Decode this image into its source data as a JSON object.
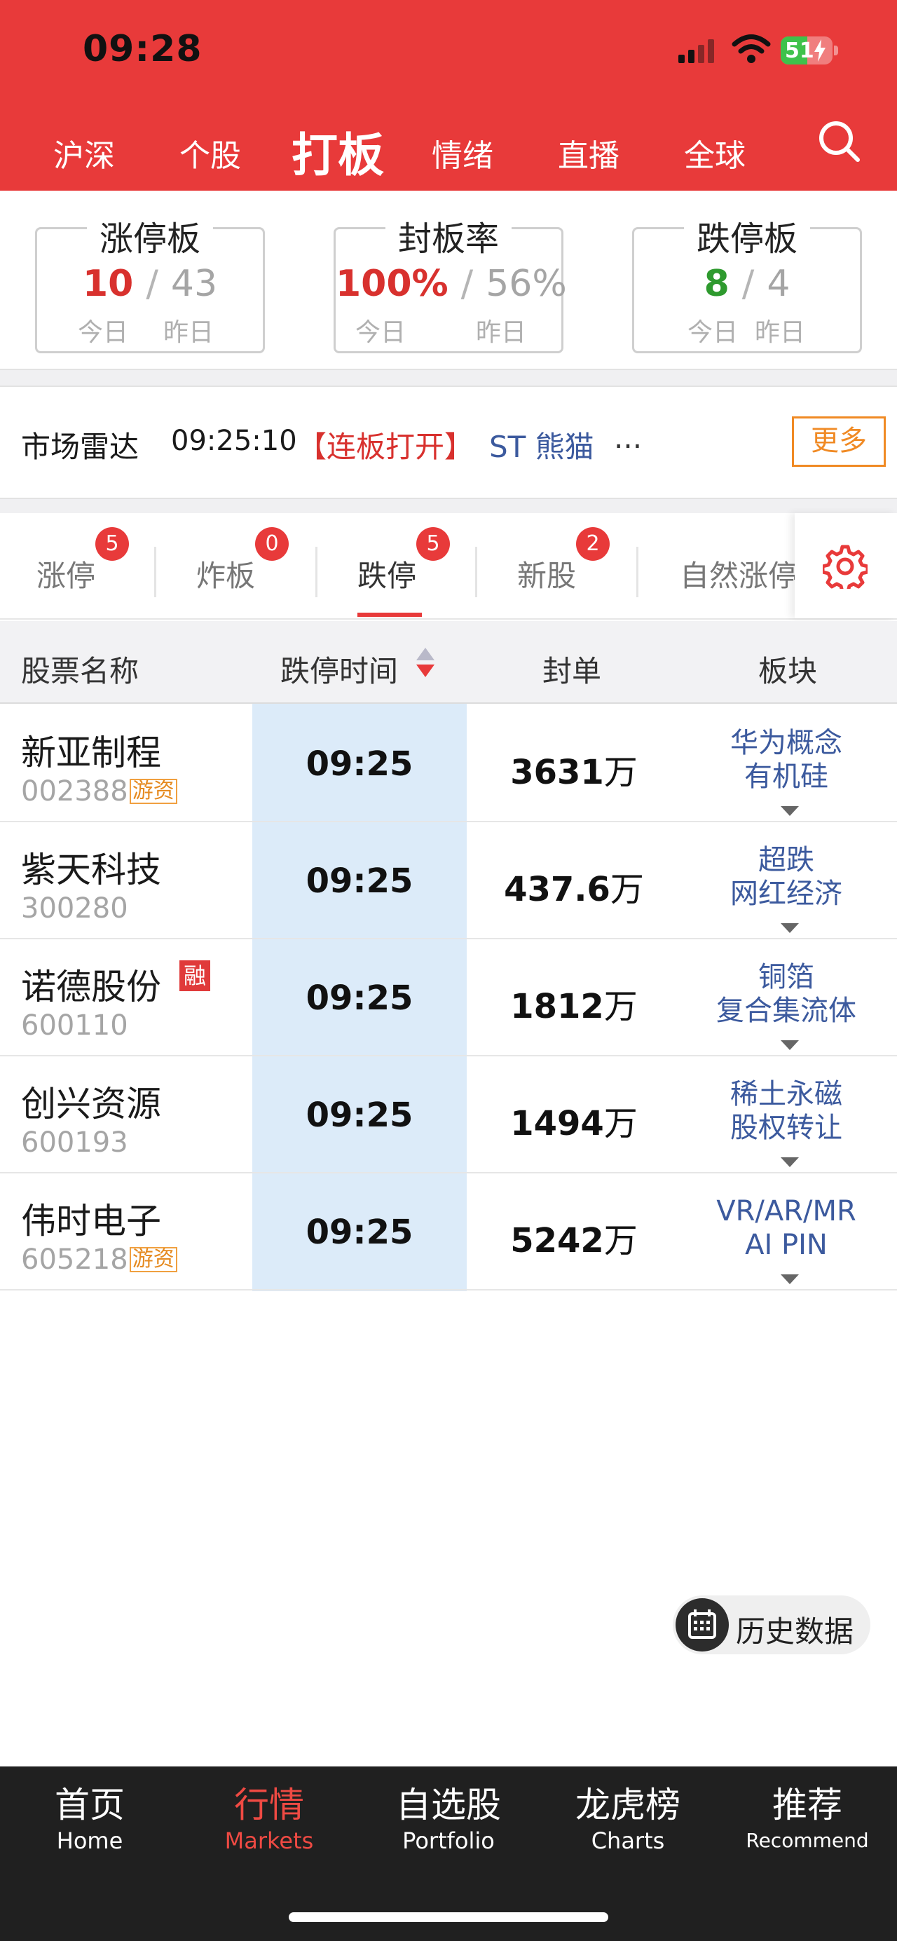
{
  "status_bar": {
    "time": "09:28",
    "battery_level": "51"
  },
  "top_nav": {
    "tabs": [
      {
        "label": "沪深"
      },
      {
        "label": "个股"
      },
      {
        "label": "打板",
        "active": true
      },
      {
        "label": "情绪"
      },
      {
        "label": "直播"
      },
      {
        "label": "全球"
      }
    ],
    "search_icon": "search-icon"
  },
  "summary": {
    "limit_up": {
      "title": "涨停板",
      "today": "10",
      "sep": "/",
      "yesterday": "43",
      "today_label": "今日",
      "yesterday_label": "昨日"
    },
    "seal_rate": {
      "title": "封板率",
      "today": "100%",
      "sep": "/",
      "yesterday": "56%",
      "today_label": "今日",
      "yesterday_label": "昨日"
    },
    "limit_down": {
      "title": "跌停板",
      "today": "8",
      "sep": "/",
      "yesterday": "4",
      "today_label": "今日",
      "yesterday_label": "昨日"
    }
  },
  "radar": {
    "label": "市场雷达",
    "time": "09:25:10",
    "tag": "【连板打开】",
    "stock": "ST 熊猫",
    "ellipsis": "...",
    "more": "更多"
  },
  "sub_tabs": [
    {
      "label": "涨停",
      "badge": "5"
    },
    {
      "label": "炸板",
      "badge": "0"
    },
    {
      "label": "跌停",
      "badge": "5",
      "active": true
    },
    {
      "label": "新股",
      "badge": "2"
    },
    {
      "label": "自然涨停"
    }
  ],
  "table": {
    "headers": {
      "name": "股票名称",
      "time": "跌停时间",
      "order": "封单",
      "sector": "板块"
    },
    "rows": [
      {
        "name": "新亚制程",
        "code": "002388",
        "tag": "游资",
        "time": "09:25",
        "order": "3631",
        "unit": "万",
        "sectors": [
          "华为概念",
          "有机硅"
        ]
      },
      {
        "name": "紫天科技",
        "code": "300280",
        "tag": "",
        "time": "09:25",
        "order": "437.6",
        "unit": "万",
        "sectors": [
          "超跌",
          "网红经济"
        ]
      },
      {
        "name": "诺德股份",
        "code": "600110",
        "tag": "融",
        "time": "09:25",
        "order": "1812",
        "unit": "万",
        "sectors": [
          "铜箔",
          "复合集流体"
        ]
      },
      {
        "name": "创兴资源",
        "code": "600193",
        "tag": "",
        "time": "09:25",
        "order": "1494",
        "unit": "万",
        "sectors": [
          "稀土永磁",
          "股权转让"
        ]
      },
      {
        "name": "伟时电子",
        "code": "605218",
        "tag": "游资",
        "time": "09:25",
        "order": "5242",
        "unit": "万",
        "sectors": [
          "VR/AR/MR",
          "AI PIN"
        ]
      }
    ]
  },
  "history_button": {
    "label": "历史数据",
    "icon": "calendar-icon"
  },
  "bottom_nav": [
    {
      "zh": "首页",
      "en": "Home"
    },
    {
      "zh": "行情",
      "en": "Markets",
      "active": true
    },
    {
      "zh": "自选股",
      "en": "Portfolio"
    },
    {
      "zh": "龙虎榜",
      "en": "Charts"
    },
    {
      "zh": "推荐",
      "en": "Recommend"
    }
  ],
  "colors": {
    "header_red": "#e83a3a",
    "up_red": "#d8312e",
    "down_green": "#2e9a2e",
    "link_blue": "#3c5a9e",
    "sort_col": "#dcebf9"
  }
}
